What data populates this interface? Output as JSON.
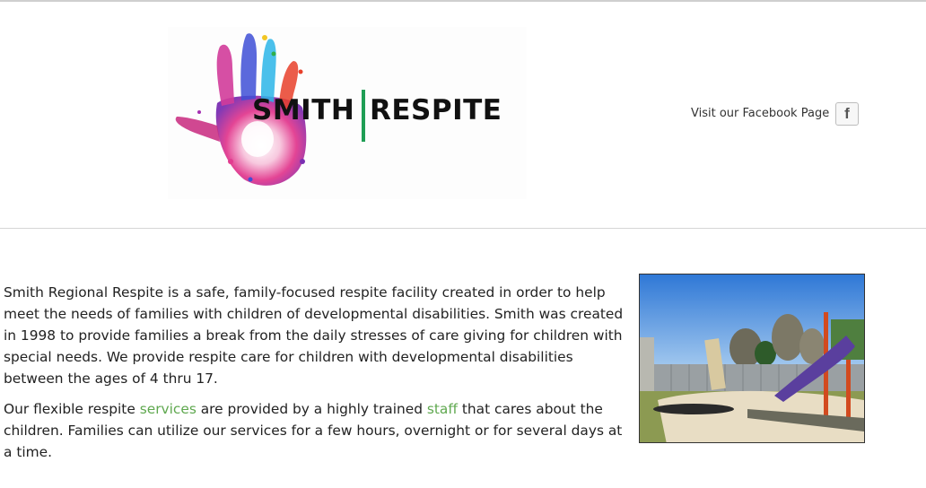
{
  "header": {
    "logo": {
      "word_left": "SMITH",
      "word_right": "RESPITE",
      "bar_color": "#1f9e55"
    },
    "facebook": {
      "label": "Visit our Facebook Page",
      "icon_glyph": "f",
      "icon": "facebook-icon"
    }
  },
  "main": {
    "paragraph1": "Smith Regional Respite is a safe, family-focused respite facility created in order to help meet the needs of families with children of developmental disabilities.  Smith was created in 1998 to provide families a break from the daily stresses of care giving for children with special needs.  We provide respite care for children with developmental disabilities between the ages of 4 thru 17.",
    "paragraph2": {
      "part1": "Our flexible respite ",
      "link_services": "services",
      "part2": " are provided by a highly trained ",
      "link_staff": "staff",
      "part3": " that cares about the children.  Families can utilize our services for a few hours, overnight or for several days at a time."
    },
    "link_color": "#5fa84f",
    "photo_icon": "playground-photo"
  }
}
